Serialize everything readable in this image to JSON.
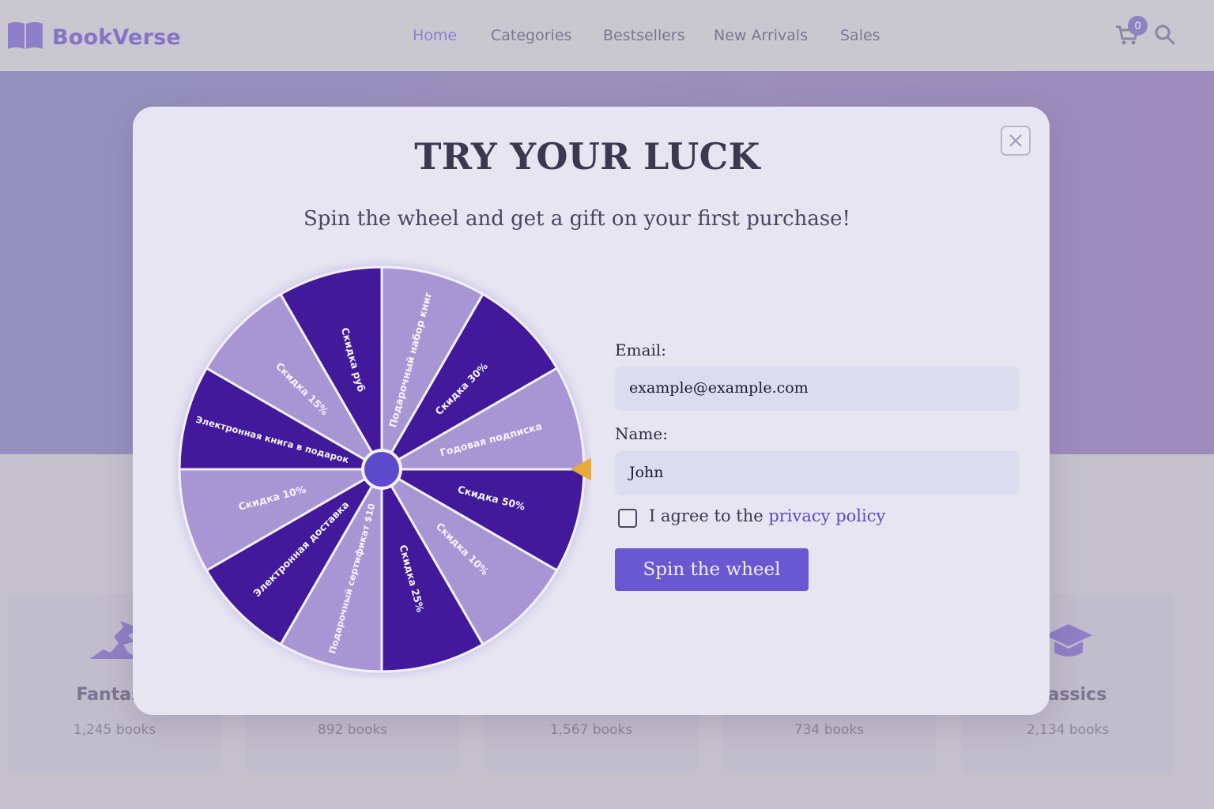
{
  "header": {
    "logo_text": "BookVerse",
    "nav": [
      {
        "label": "Home",
        "active": true
      },
      {
        "label": "Categories",
        "active": false
      },
      {
        "label": "Bestsellers",
        "active": false
      },
      {
        "label": "New Arrivals",
        "active": false
      },
      {
        "label": "Sales",
        "active": false
      }
    ],
    "cart_count": "0",
    "icons": [
      "book-logo-icon",
      "cart-icon",
      "search-icon"
    ]
  },
  "categories": [
    {
      "name": "Fantasy",
      "count": "1,245 books",
      "icon": "dragon-icon"
    },
    {
      "name": "",
      "count": "892 books"
    },
    {
      "name": "",
      "count": "1,567 books"
    },
    {
      "name": "",
      "count": "734 books"
    },
    {
      "name": "Classics",
      "count": "2,134 books",
      "icon": "graduation-cap-icon"
    }
  ],
  "modal": {
    "title": "TRY YOUR LUCK",
    "subtitle": "Spin the wheel and get a gift on your first purchase!",
    "close_icon": "close-icon",
    "wheel": {
      "segments": [
        "Подарочный набор книг",
        "Скидка 30%",
        "Годовая подписка",
        "Скидка 50%",
        "Скидка 10%",
        "Скидка 25%",
        "Подарочный сертификат $10",
        "Электронная доставка",
        "Скидка 10%",
        "Электронная книга в подарок",
        "Скидка 15%",
        "Скидка руб"
      ],
      "colors": {
        "dark": "#42199b",
        "light": "#a896d4",
        "hub": "#5d49cc",
        "pointer": "#eba93a"
      }
    },
    "form": {
      "email_label": "Email:",
      "email_value": "example@example.com",
      "name_label": "Name:",
      "name_value": "John",
      "agree_text": "I agree to the ",
      "agree_link": "privacy policy",
      "spin_button": "Spin the wheel"
    }
  }
}
